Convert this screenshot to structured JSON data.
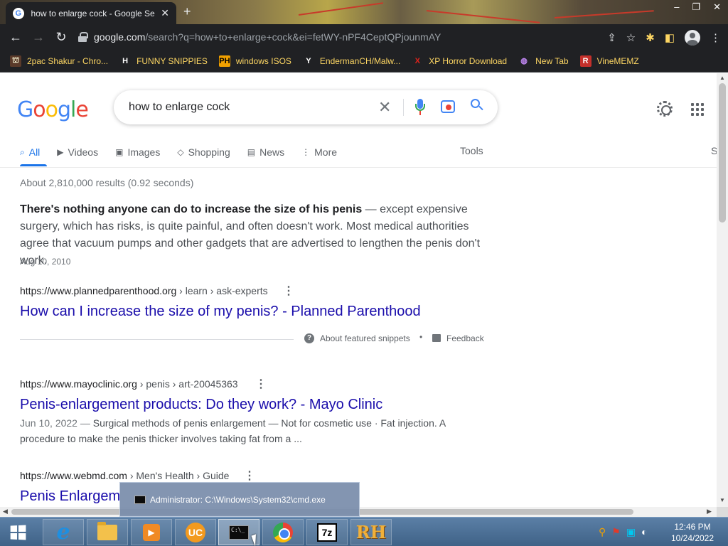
{
  "browser": {
    "tab_title": "how to enlarge cock - Google Se",
    "tab_icon": "G",
    "url_domain": "google.com",
    "url_path": "/search?q=how+to+enlarge+cock&ei=fetWY-nPF4CeptQPjounmAY",
    "bookmarks": [
      {
        "label": "2pac Shakur - Chro...",
        "icon": "⛫",
        "icon_bg": "#5a3a2a",
        "icon_color": "#ffd"
      },
      {
        "label": "FUNNY SNIPPIES",
        "icon": "H",
        "icon_bg": "#202124",
        "icon_color": "#fff"
      },
      {
        "label": "windows ISOS",
        "icon": "PH",
        "icon_bg": "#f0a000",
        "icon_color": "#000"
      },
      {
        "label": "EndermanCH/Malw...",
        "icon": "Y",
        "icon_bg": "#202124",
        "icon_color": "#fff"
      },
      {
        "label": "XP Horror Download",
        "icon": "X",
        "icon_bg": "#202124",
        "icon_color": "#e0231c"
      },
      {
        "label": "New Tab",
        "icon": "◍",
        "icon_bg": "#202124",
        "icon_color": "#c58af9"
      },
      {
        "label": "VineMEMZ",
        "icon": "R",
        "icon_bg": "#c4302b",
        "icon_color": "#fff"
      }
    ]
  },
  "search": {
    "logo": [
      "G",
      "o",
      "o",
      "g",
      "l",
      "e"
    ],
    "logo_colors": [
      "#4285f4",
      "#ea4335",
      "#fbbc05",
      "#4285f4",
      "#34a853",
      "#ea4335"
    ],
    "query": "how to enlarge cock",
    "tabs": [
      {
        "label": "All",
        "icon": "⌕"
      },
      {
        "label": "Videos",
        "icon": "▶"
      },
      {
        "label": "Images",
        "icon": "▣"
      },
      {
        "label": "Shopping",
        "icon": "◇"
      },
      {
        "label": "News",
        "icon": "▤"
      },
      {
        "label": "More",
        "icon": "⋮"
      }
    ],
    "tools_label": "Tools",
    "right_cut_label": "S",
    "stats": "About 2,810,000 results (0.92 seconds)"
  },
  "featured": {
    "bold": "There's nothing anyone can do to increase the size of his penis",
    "text": " — except expensive surgery, which has risks, is quite painful, and often doesn't work. Most medical authorities agree that vacuum pumps and other gadgets that are advertised to lengthen the penis don't work.",
    "date": "Aug 10, 2010",
    "cite_host": "https://www.plannedparenthood.org",
    "cite_path": " › learn › ask-experts",
    "title": "How can I increase the size of my penis? - Planned Parenthood",
    "about_label": "About featured snippets",
    "bullet": "•",
    "feedback_label": "Feedback"
  },
  "results": [
    {
      "cite_host": "https://www.mayoclinic.org",
      "cite_path": " › penis › art-20045363",
      "title": "Penis-enlargement products: Do they work? - Mayo Clinic",
      "date": "Jun 10, 2022 — ",
      "snippet": "Surgical methods of penis enlargement — Not for cosmetic use · Fat injection. A procedure to make the penis thicker involves taking fat from a ..."
    },
    {
      "cite_host": "https://www.webmd.com",
      "cite_path": " › Men's Health › Guide",
      "title": "Penis Enlargem"
    }
  ],
  "taskbar": {
    "apps": [
      "internet-explorer",
      "file-explorer",
      "media-player",
      "uc-browser",
      "command-prompt",
      "chrome",
      "7-zip",
      "resource-hacker"
    ],
    "preview_title": "Administrator: C:\\Windows\\System32\\cmd.exe",
    "time": "12:46 PM",
    "date": "10/24/2022",
    "zip_label": "7z",
    "rh_label": "RH",
    "cmd_label": "C:\\_"
  }
}
